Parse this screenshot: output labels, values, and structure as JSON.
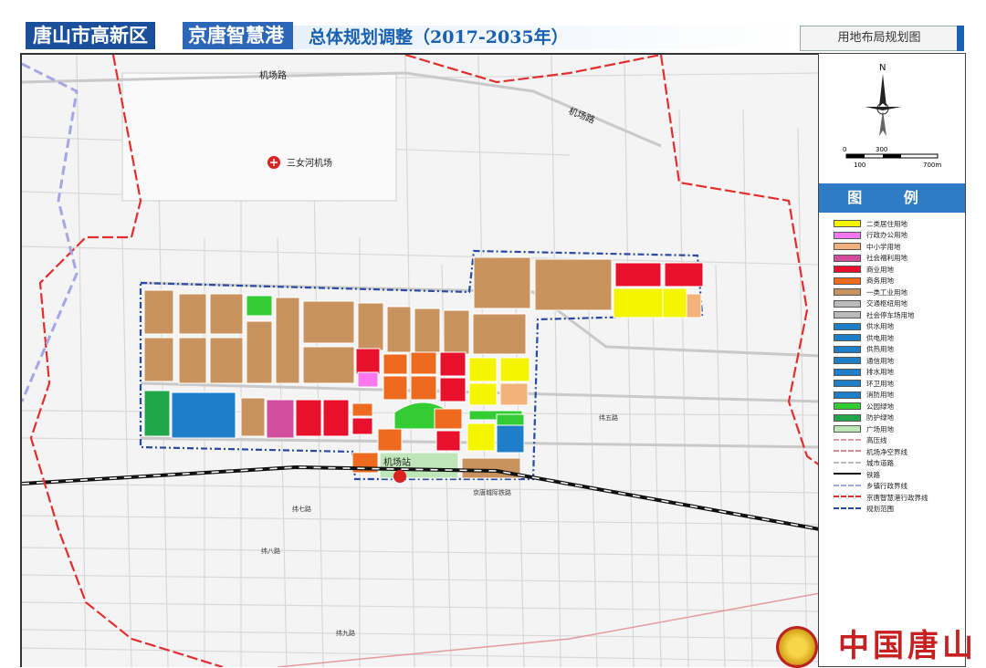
{
  "header": {
    "district": "唐山市高新区",
    "port_name": "京唐智慧港",
    "plan_title": "总体规划调整（2017-2035年）",
    "map_name": "用地布局规划图"
  },
  "north": {
    "label": "N"
  },
  "scale_bar": {
    "ticks": [
      "0",
      "300"
    ],
    "ticks_lower": [
      "100",
      "700m"
    ]
  },
  "legend": {
    "title": "图 例",
    "items": [
      {
        "label": "二类居住用地",
        "color": "#f5f500"
      },
      {
        "label": "行政办公用地",
        "color": "#ff77ee"
      },
      {
        "label": "中小学用地",
        "color": "#f2b27a"
      },
      {
        "label": "社会福利用地",
        "color": "#d24d9e"
      },
      {
        "label": "商业用地",
        "color": "#e8102c"
      },
      {
        "label": "商务用地",
        "color": "#ee6a1e"
      },
      {
        "label": "一类工业用地",
        "color": "#c8935e"
      },
      {
        "label": "交通枢纽用地",
        "color": "#bbbbbb"
      },
      {
        "label": "社会停车场用地",
        "color": "#bbbbbb"
      },
      {
        "label": "供水用地",
        "color": "#1e7fc8"
      },
      {
        "label": "供电用地",
        "color": "#1e7fc8"
      },
      {
        "label": "供热用地",
        "color": "#1e7fc8"
      },
      {
        "label": "通信用地",
        "color": "#1e7fc8"
      },
      {
        "label": "排水用地",
        "color": "#1e7fc8"
      },
      {
        "label": "环卫用地",
        "color": "#1e7fc8"
      },
      {
        "label": "消防用地",
        "color": "#1e7fc8"
      },
      {
        "label": "公园绿地",
        "color": "#33cc33"
      },
      {
        "label": "防护绿地",
        "color": "#1fa74a"
      },
      {
        "label": "广场用地",
        "color": "#bfe6b8"
      },
      {
        "label": "高压线",
        "color": "#ffffff"
      },
      {
        "label": "机场净空界线",
        "color": "#ffffff"
      },
      {
        "label": "城市道路",
        "color": "#ffffff"
      },
      {
        "label": "铁路",
        "color": "#ffffff"
      },
      {
        "label": "乡镇行政界线",
        "color": "#ffffff"
      },
      {
        "label": "京唐智慧港行政界线",
        "color": "#ffffff"
      },
      {
        "label": "规划范围",
        "color": "#ffffff"
      }
    ]
  },
  "map": {
    "labels": {
      "airport": "三女河机场",
      "airport_road_w": "机场路",
      "airport_road_e": "机场路",
      "station": "机场站",
      "rail": "京唐城际铁路",
      "road_wei7": "纬七路",
      "road_wei8": "纬八路",
      "road_wei9": "纬九路",
      "road_wei5": "纬五路"
    }
  },
  "watermark": "中国唐山"
}
